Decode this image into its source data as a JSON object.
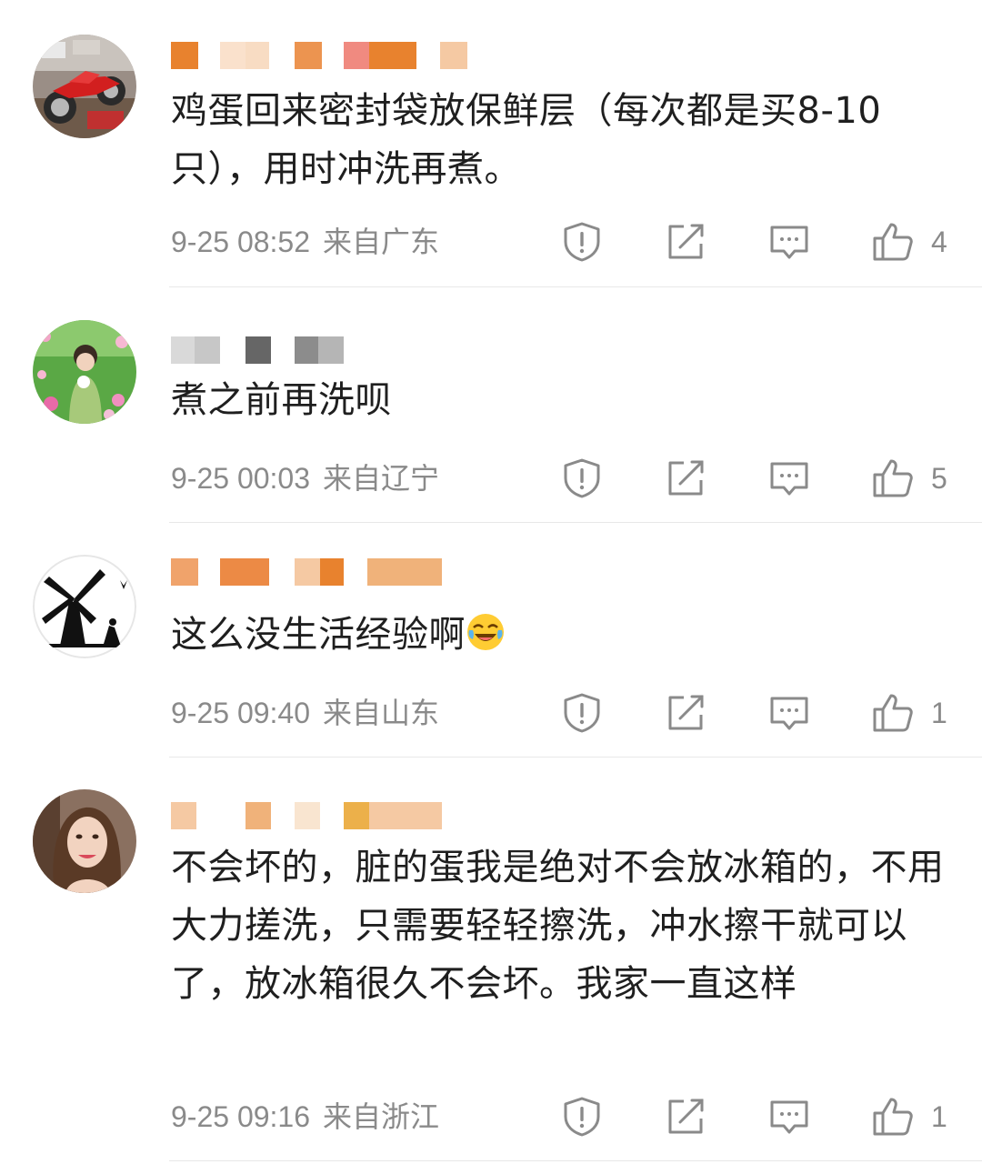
{
  "comments": [
    {
      "text": "鸡蛋回来密封袋放保鲜层（每次都是买8-10只），用时冲洗再煮。",
      "time": "9-25 08:52",
      "location": "来自广东",
      "likes": "4",
      "avatar_icon": "motorcycle-avatar-icon",
      "name_colors": [
        "#e8822e",
        "#f5c9a3",
        "#f0b27a",
        "#ec9450",
        "#f08a80"
      ]
    },
    {
      "text": "煮之前再洗呗",
      "time": "9-25 00:03",
      "location": "来自辽宁",
      "likes": "5",
      "avatar_icon": "flower-field-avatar-icon",
      "name_colors": [
        "#d9d9d9",
        "#c7c7c7",
        "#666666",
        "#8c8c8c",
        "#b5b5b5"
      ]
    },
    {
      "text": "这么没生活经验啊",
      "emoji": "laugh-cry-emoji-icon",
      "time": "9-25 09:40",
      "location": "来自山东",
      "likes": "1",
      "avatar_icon": "windmill-avatar-icon",
      "name_colors": [
        "#f0a36b",
        "#ec8a45",
        "#f5c9a3",
        "#e8822e",
        "#f0b27a"
      ]
    },
    {
      "text": "不会坏的，脏的蛋我是绝对不会放冰箱的，不用大力搓洗，只需要轻轻擦洗，冲水擦干就可以了，放冰箱很久不会坏。我家一直这样",
      "time": "9-25 09:16",
      "location": "来自浙江",
      "likes": "1",
      "avatar_icon": "woman-portrait-avatar-icon",
      "name_colors": [
        "#f5c9a3",
        "#f0b27a",
        "#f5d3b0",
        "#ecb04a"
      ]
    }
  ],
  "actions": {
    "report_icon": "report-icon",
    "share_icon": "share-icon",
    "reply_icon": "comment-icon",
    "like_icon": "thumbs-up-icon"
  },
  "colors": {
    "text": "#1f1f1f",
    "meta": "#8a8a8a",
    "divider": "#e8e8e8"
  }
}
